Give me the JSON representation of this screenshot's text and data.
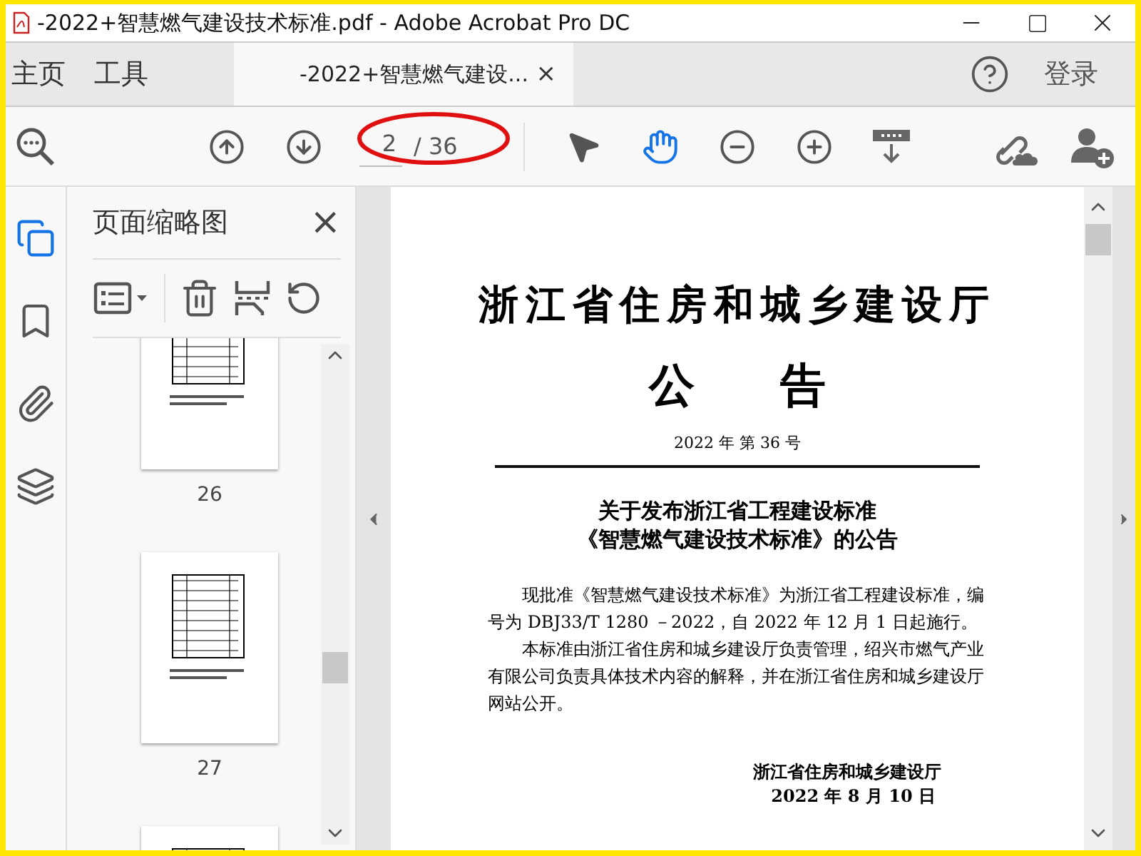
{
  "window": {
    "title": "-2022+智慧燃气建设技术标准.pdf - Adobe Acrobat Pro DC"
  },
  "nav": [
    {
      "label": "主页",
      "selected": false
    },
    {
      "label": "工具",
      "selected": false
    }
  ],
  "document_tab": {
    "label": "-2022+智慧燃气建设...",
    "close": "×",
    "selected": true
  },
  "sign_in": "登录",
  "toolbar": {
    "page_value": "2",
    "page_total": "/ 36",
    "tools": [
      {
        "kind": "select",
        "selected": false
      },
      {
        "kind": "hand",
        "selected": true
      }
    ]
  },
  "sidebar_rail": [
    {
      "kind": "pages",
      "selected": true
    },
    {
      "kind": "bookmarks",
      "selected": false
    },
    {
      "kind": "attachments",
      "selected": false
    },
    {
      "kind": "layers",
      "selected": false
    }
  ],
  "thumbnails_panel": {
    "title": "页面缩略图",
    "close": "×",
    "thumbnails": [
      {
        "label": "26",
        "selected": false
      },
      {
        "label": "27",
        "selected": false
      },
      {
        "selected": false
      }
    ]
  },
  "document": {
    "heading": "浙江省住房和城乡建设厅",
    "subheading": "公告",
    "number": "2022 年  第 36 号",
    "title_lines": [
      "关于发布浙江省工程建设标准",
      "《智慧燃气建设技术标准》的公告"
    ],
    "paragraphs": [
      "现批准《智慧燃气建设技术标准》为浙江省工程建设标准，编号为 DBJ33/T 1280 －2022，自 2022 年 12 月 1 日起施行。",
      "本标准由浙江省住房和城乡建设厅负责管理，绍兴市燃气产业有限公司负责具体技术内容的解释，并在浙江省住房和城乡建设厅网站公开。"
    ],
    "signature": "浙江省住房和城乡建设厅",
    "date": "2022 年 8 月 10 日"
  }
}
